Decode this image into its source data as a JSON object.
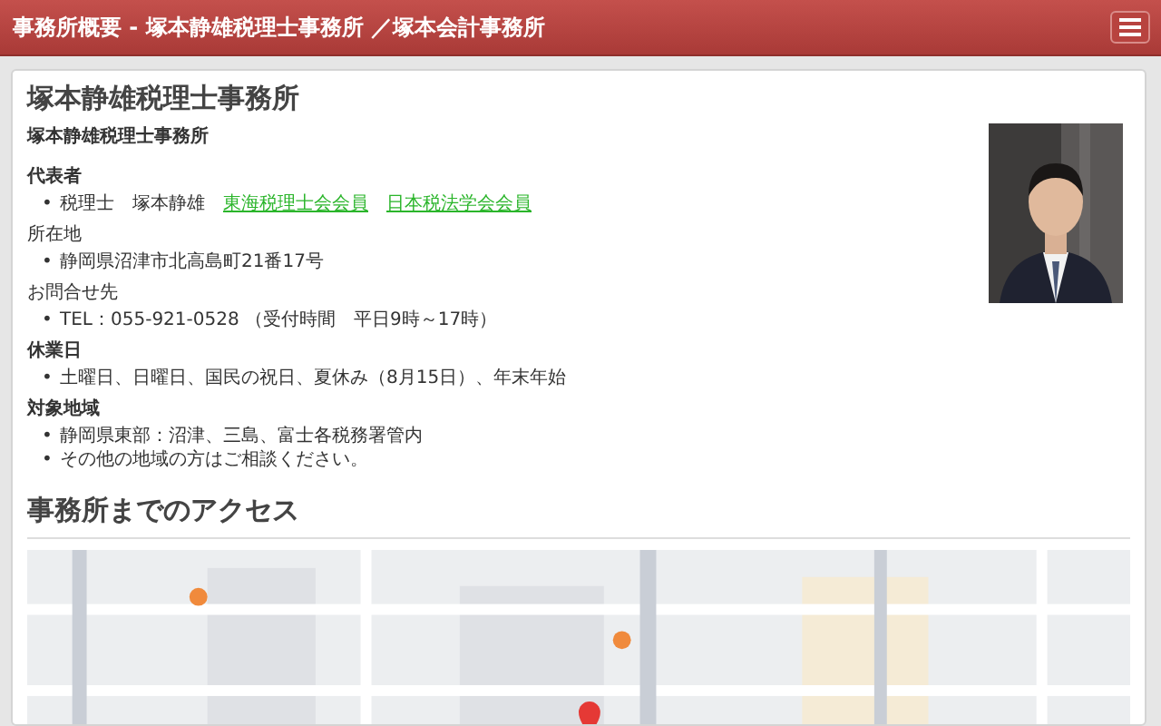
{
  "header": {
    "title": "事務所概要 - 塚本静雄税理士事務所 ／塚本会計事務所"
  },
  "office": {
    "title": "塚本静雄税理士事務所",
    "name": "塚本静雄税理士事務所",
    "sections": [
      {
        "heading": "代表者",
        "bold": true,
        "items": [
          {
            "bullet": "•",
            "text": "税理士　塚本静雄",
            "links": [
              "東海税理士会会員",
              "日本税法学会会員"
            ]
          }
        ]
      },
      {
        "heading": "所在地",
        "bold": false,
        "items": [
          {
            "bullet": "•",
            "text": "静岡県沼津市北高島町21番17号"
          }
        ]
      },
      {
        "heading": "お問合せ先",
        "bold": false,
        "items": [
          {
            "bullet": "•",
            "text": "TEL：055-921-0528 （受付時間　平日9時～17時）"
          }
        ]
      },
      {
        "heading": "休業日",
        "bold": true,
        "items": [
          {
            "bullet": "•",
            "text": "土曜日、日曜日、国民の祝日、夏休み（8月15日）、年末年始"
          }
        ]
      },
      {
        "heading": "対象地域",
        "bold": true,
        "items": [
          {
            "bullet": "•",
            "text": "静岡県東部：沼津、三島、富士各税務署管内"
          },
          {
            "bullet": "•",
            "text": "その他の地域の方はご相談ください。"
          }
        ]
      }
    ]
  },
  "access": {
    "heading": "事務所までのアクセス"
  }
}
